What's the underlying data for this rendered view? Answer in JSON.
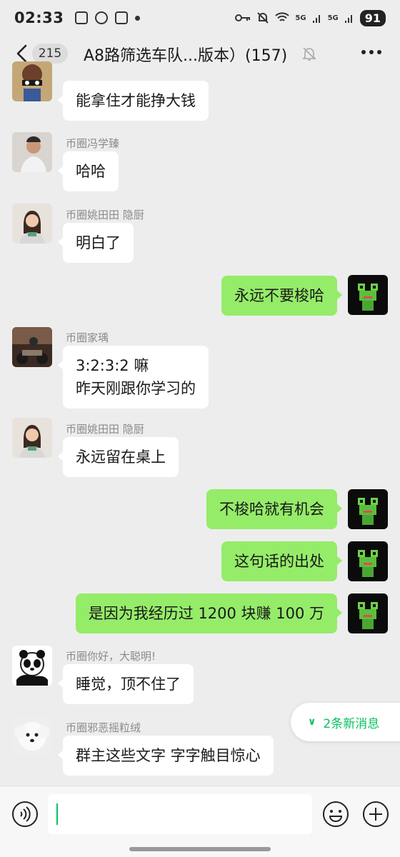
{
  "status_bar": {
    "time": "02:33",
    "battery": "91",
    "net_a": "5G",
    "net_b": "5G"
  },
  "header": {
    "unread_count": "215",
    "title": "A8路筛选车队...版本）(157)"
  },
  "messages": [
    {
      "sender": "",
      "text": "能拿住才能挣大钱",
      "avatar": "cartoon-figure"
    },
    {
      "sender": "币圈冯学臻",
      "text": "哈哈",
      "avatar": "man-portrait"
    },
    {
      "sender": "币圈姚田田 隐厨",
      "text": "明白了",
      "avatar": "woman-portrait"
    },
    {
      "sender": "",
      "text": "永远不要梭哈",
      "avatar": "pixel-frog"
    },
    {
      "sender": "币圈家瑀",
      "text": "3:2:3:2 嘛\n昨天刚跟你学习的",
      "avatar": "motorcycle-photo"
    },
    {
      "sender": "币圈姚田田 隐厨",
      "text": "永远留在桌上",
      "avatar": "woman-portrait"
    },
    {
      "sender": "",
      "text": "不梭哈就有机会",
      "avatar": "pixel-frog"
    },
    {
      "sender": "",
      "text": "这句话的出处",
      "avatar": "pixel-frog"
    },
    {
      "sender": "",
      "text": "是因为我经历过 1200 块赚 100 万",
      "avatar": "pixel-frog"
    },
    {
      "sender": "币圈你好，大聪明!",
      "text": "睡觉，顶不住了",
      "avatar": "panda-meme"
    },
    {
      "sender": "币圈邪恶摇粒绒",
      "text": "群主这些文字 字字触目惊心",
      "avatar": "white-dog"
    }
  ],
  "new_messages": {
    "label": "2条新消息"
  },
  "input": {
    "value": "",
    "placeholder": ""
  },
  "colors": {
    "accent": "#07c160",
    "outgoing_bubble": "#95ec69",
    "background": "#ededed"
  }
}
